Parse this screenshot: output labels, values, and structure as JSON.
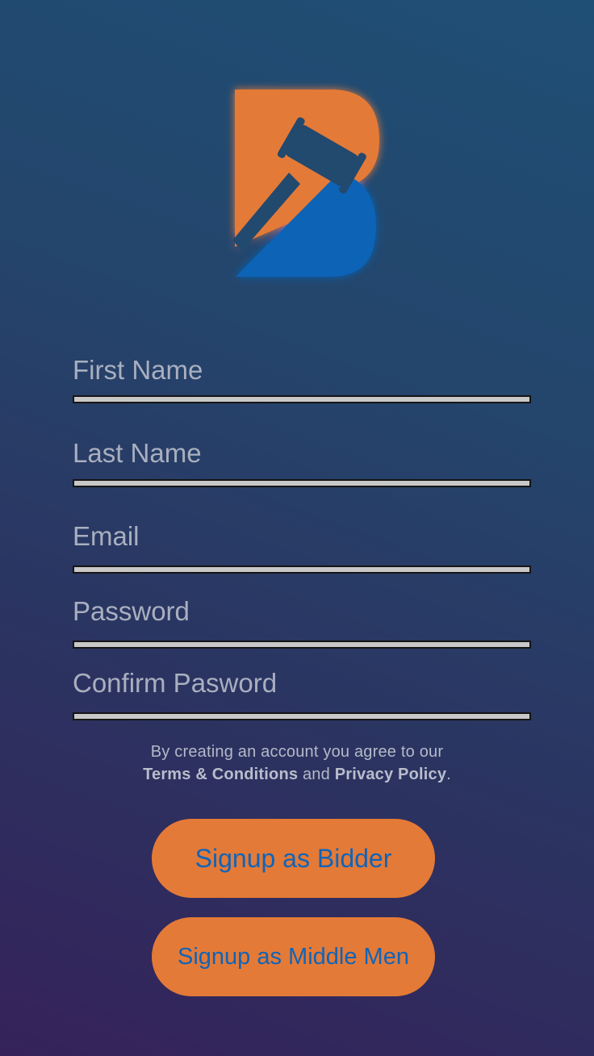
{
  "app": {
    "logo_icon": "gavel-b-logo-icon",
    "colors": {
      "brand_orange": "#e47a37",
      "brand_blue": "#0a63b6",
      "label_gray": "#a9afbf"
    }
  },
  "form": {
    "first_name": {
      "label": "First Name"
    },
    "last_name": {
      "label": "Last Name"
    },
    "email": {
      "label": "Email"
    },
    "password": {
      "label": "Password"
    },
    "confirm_password": {
      "label": "Confirm Pasword"
    }
  },
  "terms": {
    "prefix": "By creating an account you agree to our",
    "terms_link": "Terms & Conditions",
    "and": "and",
    "privacy_link": "Privacy Policy",
    "suffix": "."
  },
  "buttons": {
    "signup_bidder": "Signup as Bidder",
    "signup_middle_men": "Signup as Middle Men"
  }
}
